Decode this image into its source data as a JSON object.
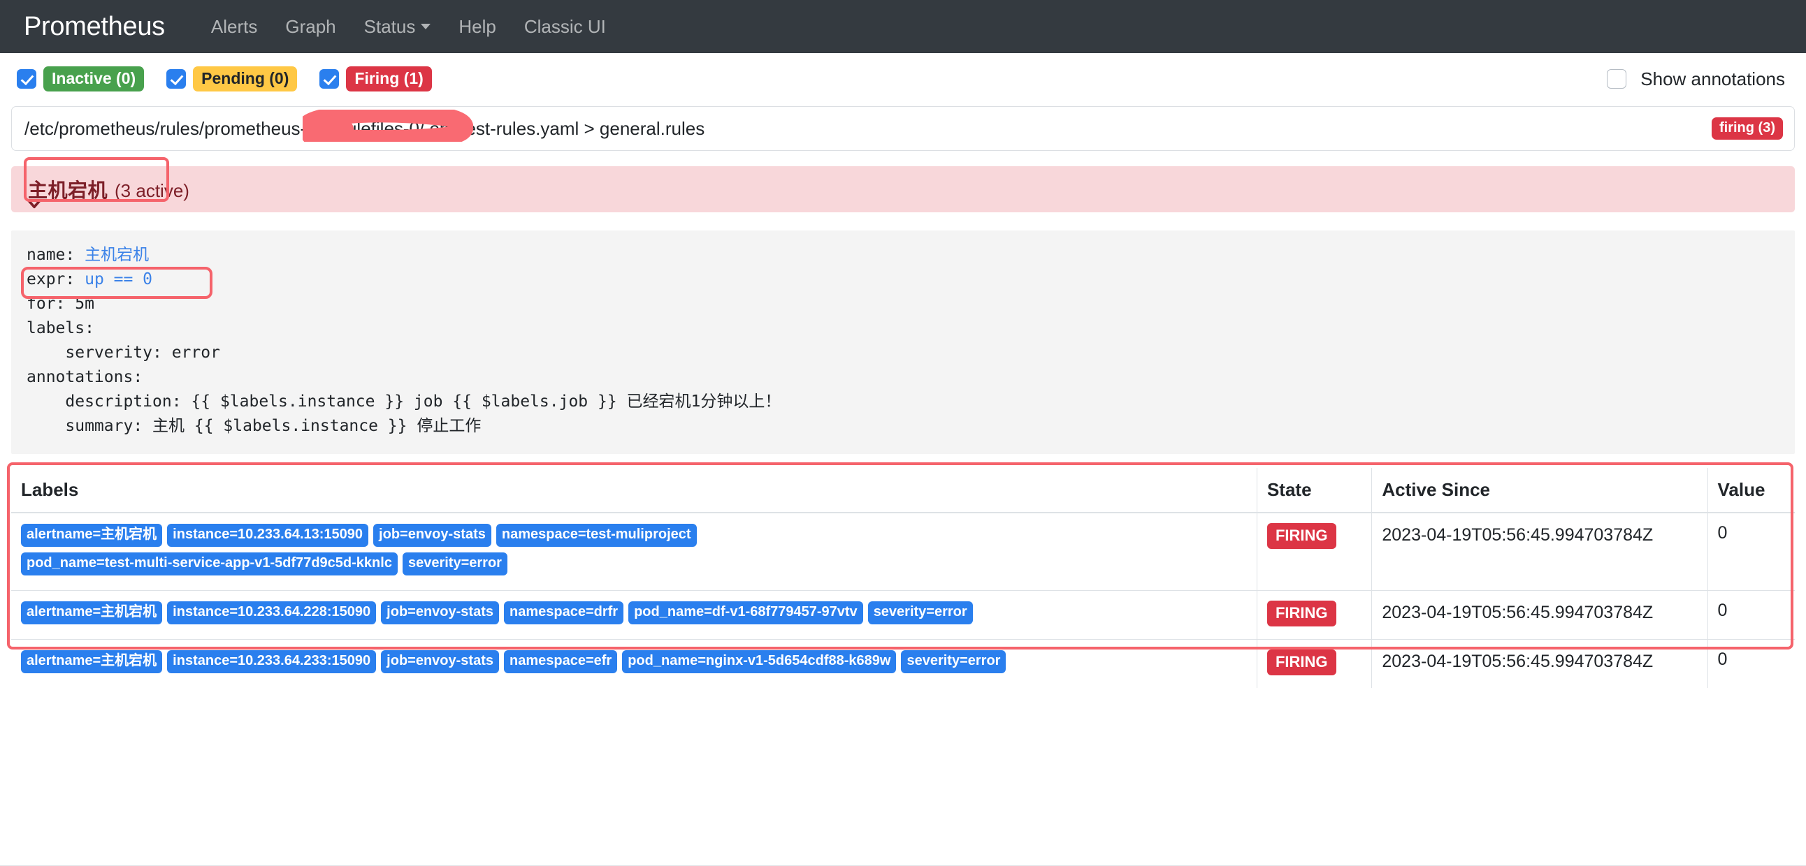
{
  "navbar": {
    "brand": "Prometheus",
    "items": [
      {
        "label": "Alerts",
        "name": "nav-alerts"
      },
      {
        "label": "Graph",
        "name": "nav-graph"
      },
      {
        "label": "Status",
        "name": "nav-status",
        "has_caret": true
      },
      {
        "label": "Help",
        "name": "nav-help"
      },
      {
        "label": "Classic UI",
        "name": "nav-classic-ui"
      }
    ]
  },
  "filters": {
    "inactive": {
      "label": "Inactive (0)",
      "checked": true,
      "color": "#48a14d"
    },
    "pending": {
      "label": "Pending (0)",
      "checked": true,
      "color": "#ffc845"
    },
    "firing": {
      "label": "Firing (1)",
      "checked": true,
      "color": "#dc3545"
    },
    "show_annotations": {
      "label": "Show annotations",
      "checked": false
    }
  },
  "rule_file": {
    "path": "/etc/prometheus/rules/prometheus-k8s-rulefiles-0/                              em-test-rules.yaml > general.rules",
    "firing_badge": "firing (3)"
  },
  "alert_group": {
    "title": "主机宕机",
    "active_count": "(3 active)",
    "expanded": true
  },
  "rule_definition": {
    "line_name_key": "name: ",
    "line_name_value": "主机宕机",
    "line_expr_key": "expr: ",
    "line_expr_value": "up == 0",
    "line_for": "for: 5m",
    "line_labels": "labels:",
    "line_severity": "    serverity: error",
    "line_annotations": "annotations:",
    "line_description": "    description: {{ $labels.instance }} job {{ $labels.job }} 已经宕机1分钟以上！",
    "line_summary": "    summary: 主机 {{ $labels.instance }} 停止工作"
  },
  "alerts_table": {
    "headers": {
      "labels": "Labels",
      "state": "State",
      "active_since": "Active Since",
      "value": "Value"
    },
    "rows": [
      {
        "labels": [
          "alertname=主机宕机",
          "instance=10.233.64.13:15090",
          "job=envoy-stats",
          "namespace=test-muliproject",
          "pod_name=test-multi-service-app-v1-5df77d9c5d-kknlc",
          "severity=error"
        ],
        "state": "FIRING",
        "active_since": "2023-04-19T05:56:45.994703784Z",
        "value": "0"
      },
      {
        "labels": [
          "alertname=主机宕机",
          "instance=10.233.64.228:15090",
          "job=envoy-stats",
          "namespace=drfr",
          "pod_name=df-v1-68f779457-97vtv",
          "severity=error"
        ],
        "state": "FIRING",
        "active_since": "2023-04-19T05:56:45.994703784Z",
        "value": "0"
      },
      {
        "labels": [
          "alertname=主机宕机",
          "instance=10.233.64.233:15090",
          "job=envoy-stats",
          "namespace=efr",
          "pod_name=nginx-v1-5d654cdf88-k689w",
          "severity=error"
        ],
        "state": "FIRING",
        "active_since": "2023-04-19T05:56:45.994703784Z",
        "value": "0"
      }
    ]
  },
  "annotations_overlay": {
    "redaction_color": "#f96a72",
    "highlight_color": "#f5636b"
  }
}
